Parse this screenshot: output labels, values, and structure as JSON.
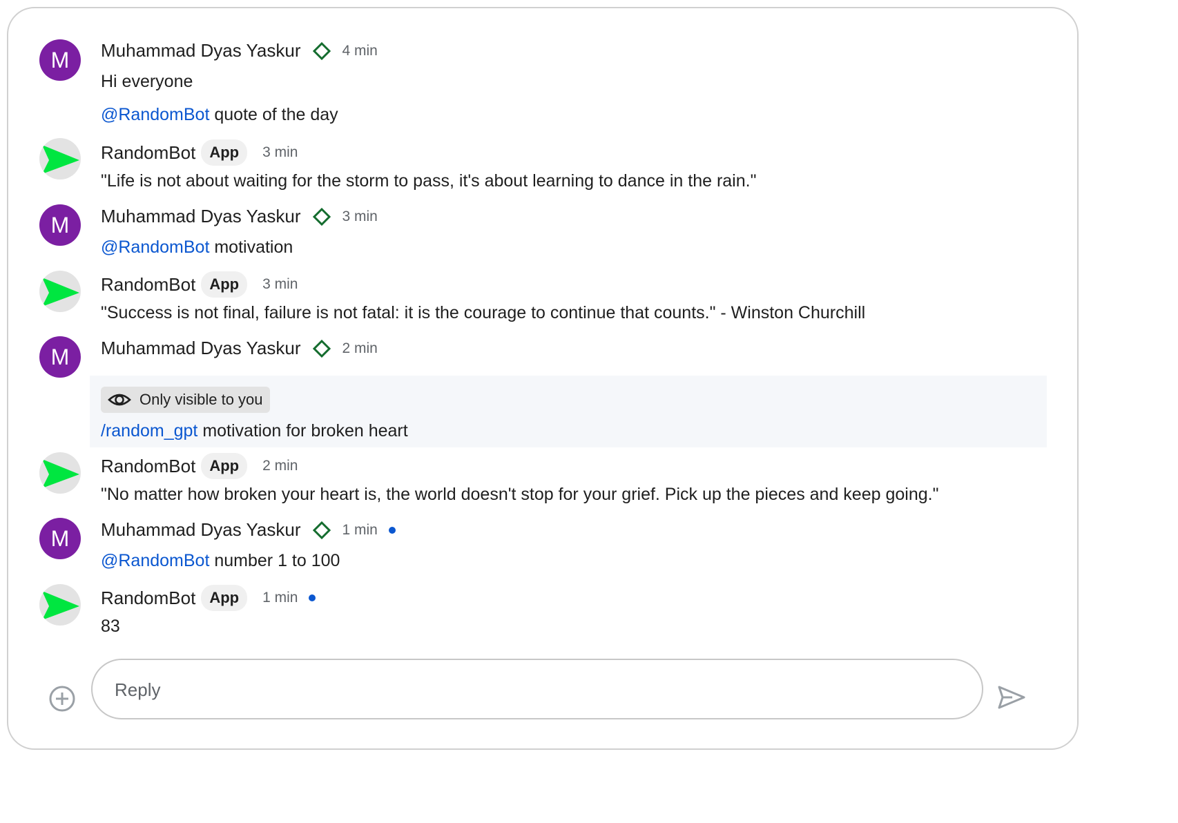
{
  "messages": [
    {
      "sender": "Muhammad Dyas Yaskur",
      "time": "4 min",
      "lines": [
        {
          "text": "Hi everyone"
        },
        {
          "mention": "@RandomBot",
          "text": " quote of the day"
        }
      ]
    },
    {
      "sender": "RandomBot",
      "badge": "App",
      "time": "3 min",
      "lines": [
        {
          "text": "\"Life is not about waiting for the storm to pass, it's about learning to dance in the rain.\""
        }
      ]
    },
    {
      "sender": "Muhammad Dyas Yaskur",
      "time": "3 min",
      "lines": [
        {
          "mention": "@RandomBot",
          "text": " motivation"
        }
      ]
    },
    {
      "sender": "RandomBot",
      "badge": "App",
      "time": "3 min",
      "lines": [
        {
          "text": "\"Success is not final, failure is not fatal: it is the courage to continue that counts.\" - Winston Churchill"
        }
      ]
    },
    {
      "sender": "Muhammad Dyas Yaskur",
      "time": "2 min",
      "visibility": "Only visible to you",
      "lines": [
        {
          "mention": "/random_gpt",
          "text": " motivation for broken heart"
        }
      ]
    },
    {
      "sender": "RandomBot",
      "badge": "App",
      "time": "2 min",
      "lines": [
        {
          "text": "\"No matter how broken your heart is, the world doesn't stop for your grief. Pick up the pieces and keep going.\""
        }
      ]
    },
    {
      "sender": "Muhammad Dyas Yaskur",
      "time": "1 min",
      "lines": [
        {
          "mention": "@RandomBot",
          "text": " number 1 to 100"
        }
      ]
    },
    {
      "sender": "RandomBot",
      "badge": "App",
      "time": "1 min",
      "lines": [
        {
          "text": "83"
        }
      ]
    }
  ],
  "user_avatar_letter": "M",
  "reply": {
    "placeholder": "Reply",
    "value": ""
  },
  "colors": {
    "user_avatar": "#7b1fa2",
    "bot_arrow": "#00e640",
    "mention": "#0b57d0",
    "verified": "#146c2e",
    "unread_dot": "#0b57d0"
  },
  "icons": {
    "verified": "diamond-outline-icon",
    "visibility": "eye-icon",
    "add": "add-circle-icon",
    "send": "send-icon"
  }
}
